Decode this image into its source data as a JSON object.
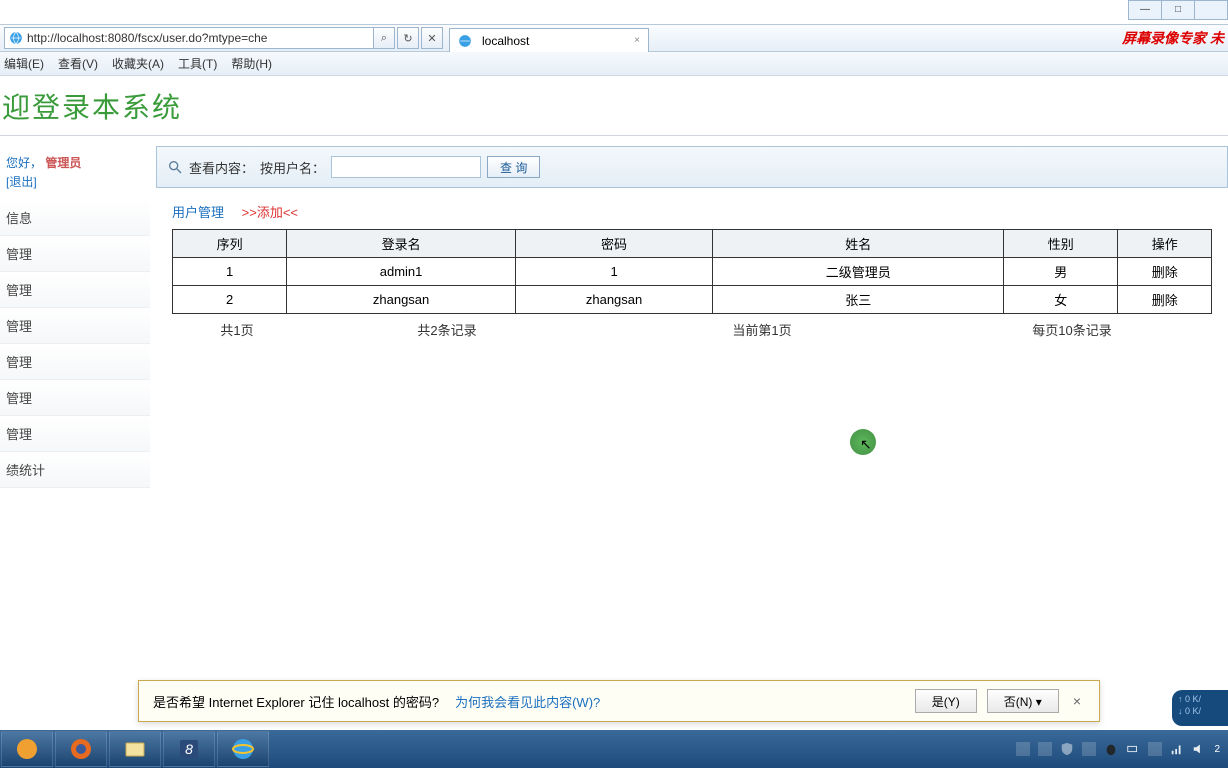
{
  "window": {
    "min": "—",
    "max": "□",
    "close": ""
  },
  "address": {
    "url": "http://localhost:8080/fscx/user.do?mtype=che",
    "search_hint": "⌕",
    "refresh": "↻",
    "stop": "✕"
  },
  "tab": {
    "title": "localhost"
  },
  "watermark": "屏幕录像专家 未",
  "menus": [
    "编辑(E)",
    "查看(V)",
    "收藏夹(A)",
    "工具(T)",
    "帮助(H)"
  ],
  "header": "迎登录本系统",
  "sidebar": {
    "greeting": "您好，",
    "role": "管理员",
    "logout": "[退出]",
    "items": [
      "信息",
      "管理",
      "管理",
      "管理",
      "管理",
      "管理",
      "管理",
      "绩统计"
    ]
  },
  "search": {
    "label": "查看内容：",
    "by": "按用户名：",
    "btn": "查 询"
  },
  "crumb": {
    "current": "用户管理",
    "add": ">>添加<<"
  },
  "table": {
    "headers": [
      "序列",
      "登录名",
      "密码",
      "姓名",
      "性别",
      "操作"
    ],
    "rows": [
      {
        "seq": "1",
        "login": "admin1",
        "pwd": "1",
        "name": "二级管理员",
        "gender": "男",
        "op": "删除"
      },
      {
        "seq": "2",
        "login": "zhangsan",
        "pwd": "zhangsan",
        "name": "张三",
        "gender": "女",
        "op": "删除"
      }
    ]
  },
  "paging": {
    "pages": "共1页",
    "records": "共2条记录",
    "current": "当前第1页",
    "per": "每页10条记录"
  },
  "notif": {
    "msg": "是否希望 Internet Explorer 记住 localhost 的密码?",
    "link": "为何我会看见此内容(W)?",
    "yes": "是(Y)",
    "no": "否(N)",
    "drop": "▾",
    "close": "×"
  },
  "net": {
    "up": "↑  0 K/",
    "down": "↓  0 K/"
  },
  "clock": {
    "time": "2",
    "date": ""
  }
}
